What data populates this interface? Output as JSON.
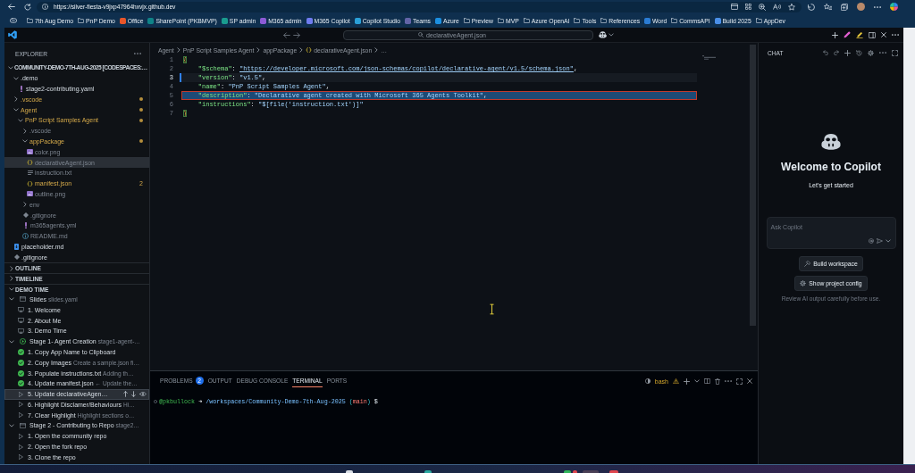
{
  "browser": {
    "url": "https://silver-fiesta-v9jxp47964hxvjx.github.dev",
    "bookmarks": [
      {
        "label": "7th Aug Demo",
        "kind": "folder"
      },
      {
        "label": "PnP Demo",
        "kind": "folder"
      },
      {
        "label": "Office",
        "kind": "site",
        "color": "#e8562a"
      },
      {
        "label": "SharePoint (PKBMVP)",
        "kind": "site",
        "color": "#0f8387"
      },
      {
        "label": "SP admin",
        "kind": "site",
        "color": "#1a9c8f"
      },
      {
        "label": "M365 admin",
        "kind": "site",
        "color": "#8d5bd6"
      },
      {
        "label": "M365 Copilot",
        "kind": "site",
        "color": "#6f7cf0"
      },
      {
        "label": "Copilot Studio",
        "kind": "site",
        "color": "#2aa0d8"
      },
      {
        "label": "Teams",
        "kind": "site",
        "color": "#6264a7"
      },
      {
        "label": "Azure",
        "kind": "site",
        "color": "#1c8fe0"
      },
      {
        "label": "Preview",
        "kind": "folder"
      },
      {
        "label": "MVP",
        "kind": "folder"
      },
      {
        "label": "Azure OpenAI",
        "kind": "folder"
      },
      {
        "label": "Tools",
        "kind": "folder"
      },
      {
        "label": "References",
        "kind": "folder"
      },
      {
        "label": "Word",
        "kind": "site",
        "color": "#2b7cd3"
      },
      {
        "label": "CommsAPI",
        "kind": "folder"
      },
      {
        "label": "Build 2025",
        "kind": "site",
        "color": "#4a8fe8"
      },
      {
        "label": "AppDev",
        "kind": "folder"
      }
    ]
  },
  "titlebar": {
    "command_center": "declarativeAgent.json"
  },
  "explorer": {
    "title": "EXPLORER",
    "root": {
      "label": "COMMUNITY-DEMO-7TH-AUG-2025 [CODESPACES:…",
      "expanded": true,
      "children": [
        {
          "label": ".demo",
          "kind": "folder",
          "expanded": true,
          "modified": false,
          "dimmed": false,
          "selected": false,
          "children": [
            {
              "label": "stage2-contributing.yaml",
              "kind": "yaml",
              "modified": false,
              "dimmed": false,
              "selected": false
            }
          ]
        },
        {
          "label": ".vscode",
          "kind": "folder",
          "expanded": false,
          "modified": true,
          "dimmed": false,
          "selected": false
        },
        {
          "label": "Agent",
          "kind": "folder",
          "expanded": true,
          "modified": true,
          "dimmed": false,
          "selected": false,
          "children": [
            {
              "label": "PnP Script Samples Agent",
              "kind": "folder",
              "expanded": true,
              "modified": true,
              "dimmed": false,
              "selected": false,
              "children": [
                {
                  "label": ".vscode",
                  "kind": "folder",
                  "expanded": false,
                  "modified": false,
                  "dimmed": true,
                  "selected": false
                },
                {
                  "label": "appPackage",
                  "kind": "folder",
                  "expanded": true,
                  "modified": true,
                  "dimmed": false,
                  "selected": false,
                  "children": [
                    {
                      "label": "color.png",
                      "kind": "image",
                      "modified": false,
                      "dimmed": true,
                      "selected": false
                    },
                    {
                      "label": "declarativeAgent.json",
                      "kind": "json",
                      "modified": false,
                      "dimmed": true,
                      "selected": true
                    },
                    {
                      "label": "instruction.txt",
                      "kind": "text",
                      "modified": false,
                      "dimmed": true,
                      "selected": false
                    },
                    {
                      "label": "manifest.json",
                      "kind": "json",
                      "modified": true,
                      "dimmed": false,
                      "selected": false,
                      "badge": "2"
                    },
                    {
                      "label": "outline.png",
                      "kind": "image",
                      "modified": false,
                      "dimmed": true,
                      "selected": false
                    }
                  ]
                },
                {
                  "label": "env",
                  "kind": "folder",
                  "expanded": false,
                  "modified": false,
                  "dimmed": true,
                  "selected": false
                },
                {
                  "label": ".gitignore",
                  "kind": "git",
                  "modified": false,
                  "dimmed": true,
                  "selected": false
                },
                {
                  "label": "m365agents.yml",
                  "kind": "yaml",
                  "modified": false,
                  "dimmed": true,
                  "selected": false
                },
                {
                  "label": "README.md",
                  "kind": "info",
                  "modified": false,
                  "dimmed": true,
                  "selected": false
                }
              ]
            }
          ]
        },
        {
          "label": "placeholder.md",
          "kind": "markdown",
          "modified": false,
          "dimmed": false,
          "selected": false
        },
        {
          "label": ".gitignore",
          "kind": "git",
          "modified": false,
          "dimmed": false,
          "selected": false
        }
      ]
    }
  },
  "sections": [
    {
      "label": "OUTLINE",
      "expanded": false
    },
    {
      "label": "TIMELINE",
      "expanded": false
    },
    {
      "label": "DEMO TIME",
      "expanded": true,
      "children": [
        {
          "label": "Slides",
          "kind": "group",
          "active": false,
          "expanded": true,
          "description": "slides.yaml",
          "selected": false,
          "children": [
            {
              "label": "1. Welcome",
              "kind": "slide",
              "selected": false
            },
            {
              "label": "2. About Me",
              "kind": "slide",
              "selected": false
            },
            {
              "label": "3. Demo Time",
              "kind": "slide",
              "selected": false
            }
          ]
        },
        {
          "label": "Stage 1- Agent Creation",
          "kind": "group",
          "active": true,
          "expanded": true,
          "description": "stage1-agent-…",
          "selected": false,
          "children": [
            {
              "label": "1. Copy App Name to Clipboard",
              "kind": "step",
              "done": true,
              "selected": false
            },
            {
              "label": "2. Copy Images",
              "kind": "step",
              "done": true,
              "description": "Create a sample.json fi…",
              "selected": false
            },
            {
              "label": "3. Populate instructions.txt",
              "kind": "step",
              "done": true,
              "description": "Adding th…",
              "selected": false
            },
            {
              "label": "4. Update manifest.json",
              "kind": "step",
              "done": true,
              "description": "← Update the…",
              "selected": false
            },
            {
              "label": "5. Update declarativeAgen…",
              "kind": "step",
              "done": false,
              "selected": true
            },
            {
              "label": "6. Highlight Disclamer/Behaviours",
              "kind": "step",
              "done": false,
              "description": "Hi…",
              "selected": false
            },
            {
              "label": "7. Clear Highlight",
              "kind": "step",
              "done": false,
              "description": "Highlight sections o…",
              "selected": false
            }
          ]
        },
        {
          "label": "Stage 2 - Contributing to Repo",
          "kind": "group",
          "active": false,
          "expanded": true,
          "description": "stage2…",
          "selected": false,
          "children": [
            {
              "label": "1. Open the community repo",
              "kind": "step",
              "done": false,
              "selected": false
            },
            {
              "label": "2. Open the fork repo",
              "kind": "step",
              "done": false,
              "selected": false
            },
            {
              "label": "3. Clone the repo",
              "kind": "step",
              "done": false,
              "selected": false
            }
          ]
        }
      ]
    }
  ],
  "editor": {
    "breadcrumbs": [
      {
        "label": "Agent",
        "kind": "folder"
      },
      {
        "label": "PnP Script Samples Agent",
        "kind": "folder"
      },
      {
        "label": "appPackage",
        "kind": "folder"
      },
      {
        "label": "declarativeAgent.json",
        "kind": "json"
      },
      {
        "label": "…",
        "kind": "symbol"
      }
    ],
    "lines": [
      {
        "number": "1",
        "indented": false,
        "current": false,
        "changed": false,
        "highlighted": false,
        "tokens": [
          {
            "text": "{",
            "kind": "bracket"
          }
        ]
      },
      {
        "number": "2",
        "indented": true,
        "current": false,
        "changed": false,
        "highlighted": false,
        "tokens": [
          {
            "text": "\"$schema\"",
            "kind": "key"
          },
          {
            "text": ": ",
            "kind": "punct"
          },
          {
            "text": "\"https://developer.microsoft.com/json-schemas/copilot/declarative-agent/v1.5/schema.json\"",
            "kind": "link"
          },
          {
            "text": ",",
            "kind": "punct"
          }
        ]
      },
      {
        "number": "3",
        "indented": true,
        "current": true,
        "changed": true,
        "highlighted": false,
        "tokens": [
          {
            "text": "\"version\"",
            "kind": "key"
          },
          {
            "text": ": ",
            "kind": "punct"
          },
          {
            "text": "\"v1.5\"",
            "kind": "string"
          },
          {
            "text": ",",
            "kind": "punct"
          }
        ]
      },
      {
        "number": "4",
        "indented": true,
        "current": false,
        "changed": false,
        "highlighted": false,
        "tokens": [
          {
            "text": "\"name\"",
            "kind": "key"
          },
          {
            "text": ": ",
            "kind": "punct"
          },
          {
            "text": "\"PnP Script Samples Agent\"",
            "kind": "string"
          },
          {
            "text": ",",
            "kind": "punct"
          }
        ]
      },
      {
        "number": "5",
        "indented": true,
        "current": false,
        "changed": false,
        "highlighted": true,
        "tokens": [
          {
            "text": "\"description\"",
            "kind": "key"
          },
          {
            "text": ": ",
            "kind": "punct"
          },
          {
            "text": "\"Declarative agent created with Microsoft 365 Agents Toolkit\"",
            "kind": "string"
          },
          {
            "text": ",",
            "kind": "punct"
          }
        ]
      },
      {
        "number": "6",
        "indented": true,
        "current": false,
        "changed": false,
        "highlighted": false,
        "tokens": [
          {
            "text": "\"instructions\"",
            "kind": "key"
          },
          {
            "text": ": ",
            "kind": "punct"
          },
          {
            "text": "\"$[file('instruction.txt')]\"",
            "kind": "string"
          }
        ]
      },
      {
        "number": "7",
        "indented": false,
        "current": false,
        "changed": false,
        "highlighted": false,
        "tokens": [
          {
            "text": "}",
            "kind": "bracket"
          }
        ]
      }
    ]
  },
  "panel": {
    "tabs": [
      {
        "label": "PROBLEMS",
        "badge": "2",
        "selected": false
      },
      {
        "label": "OUTPUT",
        "selected": false
      },
      {
        "label": "DEBUG CONSOLE",
        "selected": false
      },
      {
        "label": "TERMINAL",
        "selected": true
      },
      {
        "label": "PORTS",
        "selected": false
      }
    ],
    "shell": "bash",
    "shell_warning": true,
    "prompt": [
      {
        "text": "@pkbullock",
        "kind": "user"
      },
      {
        "text": "➜",
        "kind": "arrow"
      },
      {
        "text": "/workspaces/Community-Demo-7th-Aug-2025",
        "kind": "path"
      },
      {
        "text": "(",
        "kind": "paren-open"
      },
      {
        "text": "main",
        "kind": "branch"
      },
      {
        "text": ")",
        "kind": "paren-close"
      },
      {
        "text": "$",
        "kind": "symbol"
      }
    ]
  },
  "chat": {
    "title": "CHAT",
    "heading": "Welcome to Copilot",
    "subheading": "Let's get started",
    "input": {
      "placeholder": "Ask Copilot"
    },
    "actions": [
      {
        "label": "Build workspace",
        "kind": "build"
      },
      {
        "label": "Show project config",
        "kind": "config"
      }
    ],
    "disclaimer": "Review AI output carefully before use."
  }
}
